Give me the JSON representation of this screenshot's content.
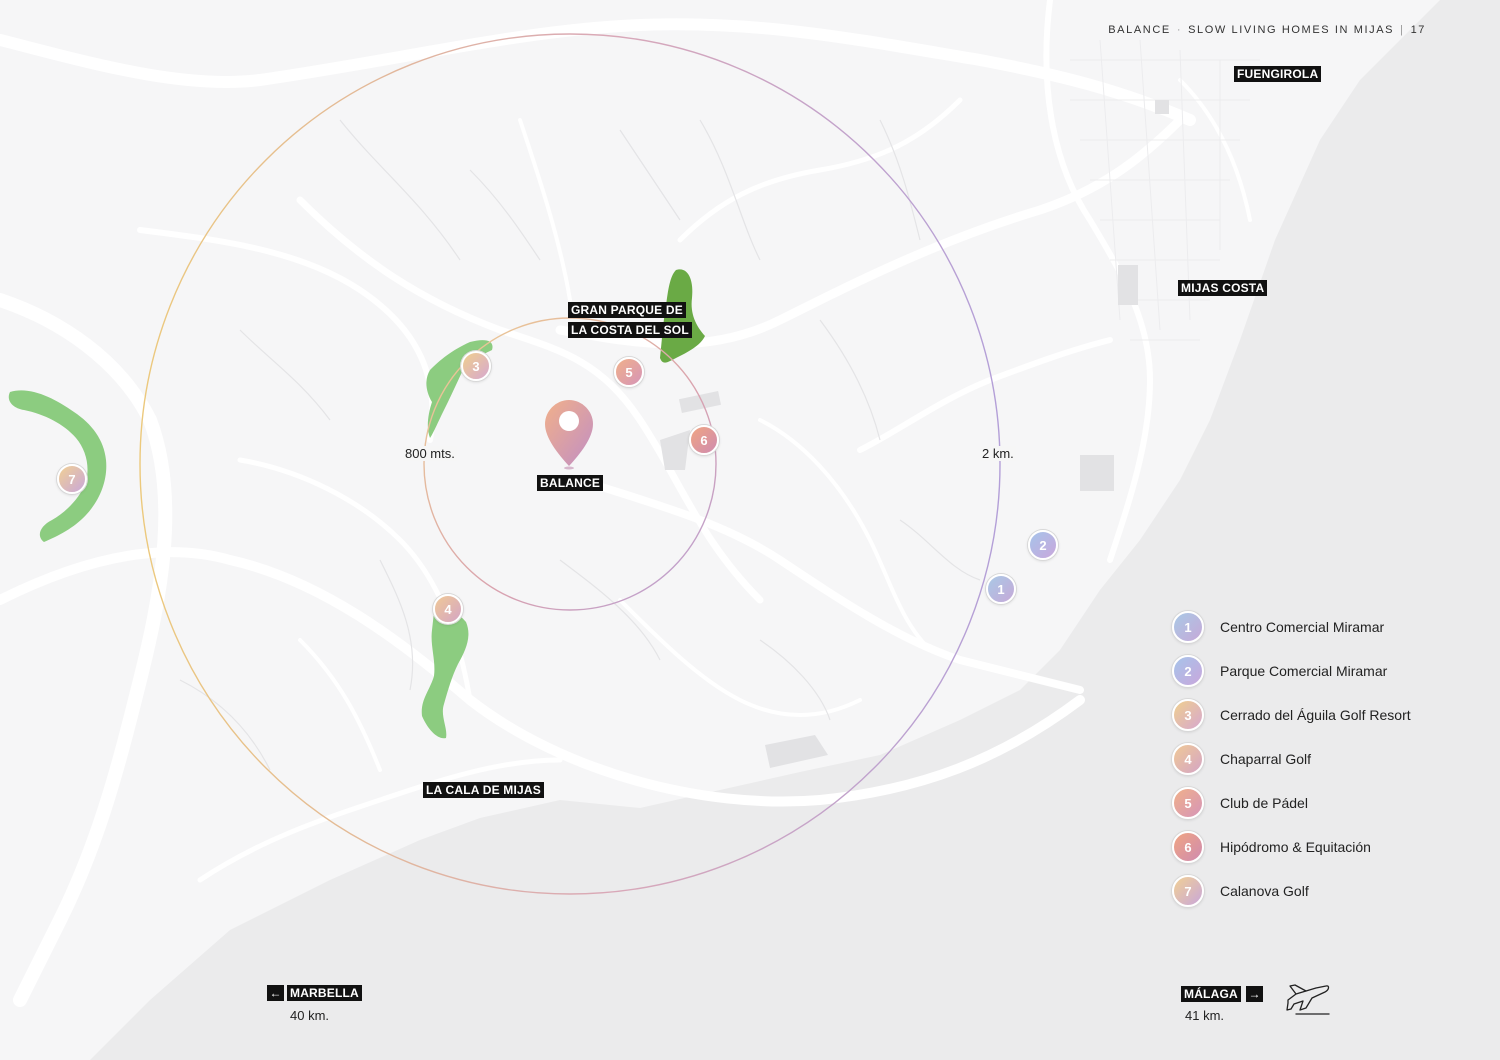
{
  "header": {
    "brand": "BALANCE",
    "separator": "·",
    "subtitle": "SLOW LIVING HOMES IN MIJAS",
    "divider": "|",
    "page": "17"
  },
  "places": {
    "fuengirola": "FUENGIROLA",
    "mijas_costa": "MIJAS COSTA",
    "gran_parque_l1": "GRAN PARQUE DE",
    "gran_parque_l2": "LA COSTA DEL SOL",
    "la_cala": "LA CALA DE MIJAS",
    "balance": "BALANCE"
  },
  "radius": {
    "inner": "800 mts.",
    "outer": "2 km."
  },
  "markers": [
    {
      "n": "1",
      "colors": [
        "#a9c9e6",
        "#c6a9d8"
      ]
    },
    {
      "n": "2",
      "colors": [
        "#a6c4ea",
        "#c9a7dc"
      ]
    },
    {
      "n": "3",
      "colors": [
        "#efcf8e",
        "#d7a8cf"
      ]
    },
    {
      "n": "4",
      "colors": [
        "#f0c996",
        "#d4a5c5"
      ]
    },
    {
      "n": "5",
      "colors": [
        "#f0b08a",
        "#d695b8"
      ]
    },
    {
      "n": "6",
      "colors": [
        "#f0a582",
        "#cf8bb0"
      ]
    },
    {
      "n": "7",
      "colors": [
        "#f1d094",
        "#c9a7da"
      ]
    }
  ],
  "legend": [
    {
      "n": "1",
      "label": "Centro Comercial Miramar"
    },
    {
      "n": "2",
      "label": "Parque Comercial Miramar"
    },
    {
      "n": "3",
      "label": "Cerrado del Águila Golf Resort"
    },
    {
      "n": "4",
      "label": "Chaparral Golf"
    },
    {
      "n": "5",
      "label": "Club de Pádel"
    },
    {
      "n": "6",
      "label": "Hipódromo & Equitación"
    },
    {
      "n": "7",
      "label": "Calanova Golf"
    }
  ],
  "destinations": {
    "marbella": {
      "arrow": "←",
      "name": "MARBELLA",
      "distance": "40 km."
    },
    "malaga": {
      "arrow": "→",
      "name": "MÁLAGA",
      "distance": "41 km.",
      "icon": "airplane-icon"
    }
  },
  "colors": {
    "park_green": "#6aaa45",
    "golf_green": "#8ccc80",
    "sea": "#ebebec",
    "land": "#f6f6f7",
    "ring_warm": "#ecc97c",
    "ring_cool": "#b8a2d8"
  }
}
